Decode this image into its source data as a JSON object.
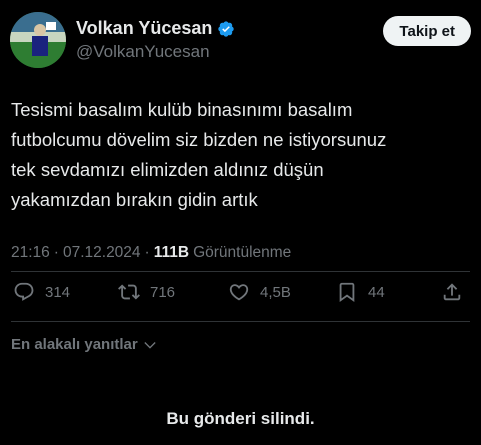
{
  "author": {
    "display_name": "Volkan Yücesan",
    "handle": "@VolkanYucesan",
    "verified": true
  },
  "follow_button": {
    "label": "Takip et"
  },
  "tweet": {
    "text": "Tesismi basalım kulüb binasınımı basalım\nfutbolcumu dövelim siz bizden ne istiyorsunuz\ntek sevdamızı elimizden aldınız düşün\nyakamızdan bırakın gidin artık",
    "time": "21:16",
    "date": "07.12.2024",
    "views_count": "111B",
    "views_label": "Görüntülenme"
  },
  "actions": {
    "replies": "314",
    "retweets": "716",
    "likes": "4,5B",
    "bookmarks": "44"
  },
  "replies_sort": {
    "label": "En alakalı yanıtlar"
  },
  "deleted_notice": "Bu gönderi silindi.",
  "colors": {
    "background": "#000000",
    "text": "#e7e9ea",
    "muted": "#71767b",
    "verified": "#1d9bf0",
    "divider": "#2f3336"
  },
  "icons": [
    "verified-badge-icon",
    "reply-icon",
    "retweet-icon",
    "like-icon",
    "bookmark-icon",
    "share-icon",
    "chevron-down-icon"
  ]
}
